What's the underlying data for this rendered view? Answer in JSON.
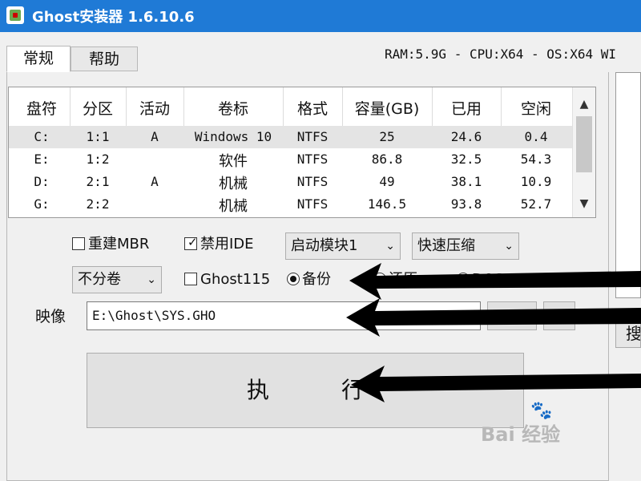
{
  "window": {
    "title": "Ghost安装器 1.6.10.6"
  },
  "tabs": [
    {
      "label": "常规"
    },
    {
      "label": "帮助"
    }
  ],
  "sysinfo": "RAM:5.9G - CPU:X64 - OS:X64 WI",
  "table": {
    "columns": [
      "盘符",
      "分区",
      "活动",
      "卷标",
      "格式",
      "容量(GB)",
      "已用",
      "空闲"
    ],
    "rows": [
      [
        "C:",
        "1:1",
        "A",
        "Windows 10",
        "NTFS",
        "25",
        "24.6",
        "0.4"
      ],
      [
        "E:",
        "1:2",
        "",
        "软件",
        "NTFS",
        "86.8",
        "32.5",
        "54.3"
      ],
      [
        "D:",
        "2:1",
        "A",
        "机械",
        "NTFS",
        "49",
        "38.1",
        "10.9"
      ],
      [
        "G:",
        "2:2",
        "",
        "机械",
        "NTFS",
        "146.5",
        "93.8",
        "52.7"
      ]
    ]
  },
  "options": {
    "rebuild_mbr": {
      "label": "重建MBR",
      "checked": false
    },
    "disable_ide": {
      "label": "禁用IDE",
      "checked": true
    },
    "boot_module": "启动模块1",
    "compression": "快速压缩",
    "split": "不分卷",
    "ghost115": {
      "label": "Ghost115",
      "checked": false
    },
    "mode_backup": "备份",
    "mode_restore": "还原",
    "mode_dos": "DOS"
  },
  "image": {
    "label": "映像",
    "path": "E:\\Ghost\\SYS.GHO",
    "browse_label": "..."
  },
  "execute_label": "执行",
  "right_button_label": "搜",
  "watermark": {
    "text": "Bai 经验",
    "brand": "du"
  }
}
